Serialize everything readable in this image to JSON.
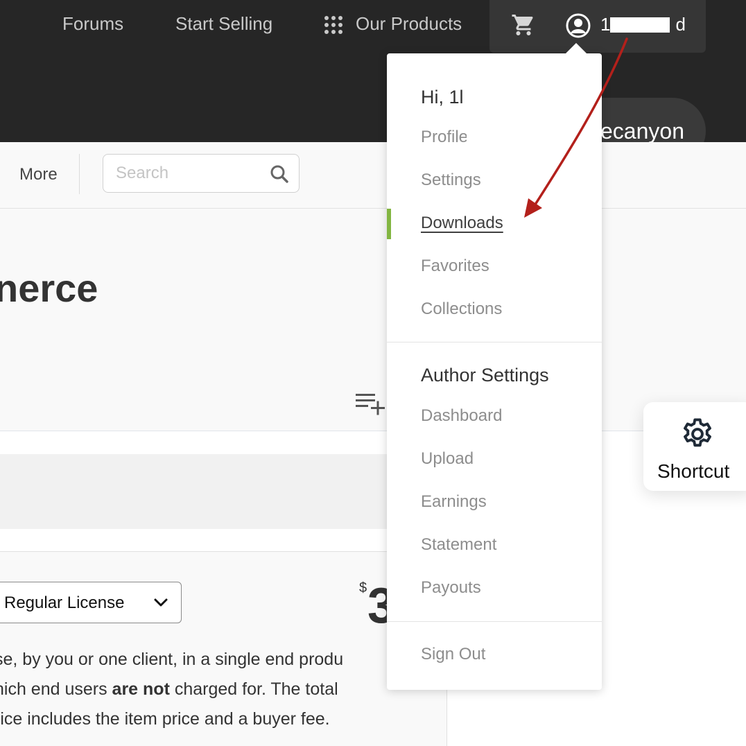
{
  "topnav": {
    "forums": "Forums",
    "start_selling": "Start Selling",
    "our_products": "Our Products",
    "username": "1",
    "username_end": "d"
  },
  "brand": {
    "text": "ecanyon"
  },
  "subnav": {
    "more": "More",
    "search_placeholder": "Search"
  },
  "page": {
    "title": "nerce",
    "license": {
      "selected": "Regular License",
      "options": [
        "Regular License"
      ]
    },
    "price": {
      "currency": "$",
      "value": "3"
    },
    "description": {
      "line1": "se, by you or one client, in a single end produ",
      "line2_pre": "hich end users ",
      "line2_bold": "are not",
      "line2_post": " charged for. The total",
      "line3": "rice includes the item price and a buyer fee."
    }
  },
  "dropdown": {
    "greeting": "Hi, 1l",
    "items": [
      {
        "label": "Profile"
      },
      {
        "label": "Settings"
      },
      {
        "label": "Downloads",
        "active": true
      },
      {
        "label": "Favorites"
      },
      {
        "label": "Collections"
      }
    ],
    "author_heading": "Author Settings",
    "author_items": [
      {
        "label": "Dashboard"
      },
      {
        "label": "Upload"
      },
      {
        "label": "Earnings"
      },
      {
        "label": "Statement"
      },
      {
        "label": "Payouts"
      }
    ],
    "sign_out": "Sign Out"
  },
  "shortcut": {
    "label": "Shortcut"
  },
  "colors": {
    "header_bg": "#262626",
    "active_indicator": "#82b541",
    "annotation_arrow": "#b3201b"
  }
}
